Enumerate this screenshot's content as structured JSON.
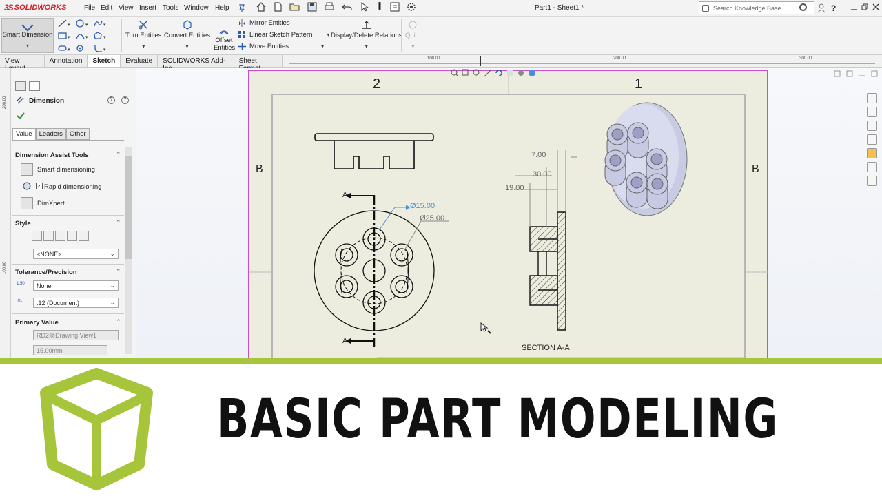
{
  "app": {
    "brand": "SOLIDWORKS",
    "brand_prefix": "3S",
    "doc_title": "Part1 - Sheet1 *",
    "menu": [
      "File",
      "Edit",
      "View",
      "Insert",
      "Tools",
      "Window",
      "Help"
    ],
    "search_placeholder": "Search Knowledge Base",
    "help_glyph": "?"
  },
  "commands": {
    "smart_dimension": "Smart Dimension",
    "trim_entities": "Trim Entities",
    "convert_entities": "Convert Entities",
    "offset_entities": "Offset Entities",
    "mirror_entities": "Mirror Entities",
    "linear_sketch_pattern": "Linear Sketch Pattern",
    "move_entities": "Move Entities",
    "display_delete_relations": "Display/Delete Relations",
    "quick_snaps": "Qui..."
  },
  "tabs": [
    "View Layout",
    "Annotation",
    "Sketch",
    "Evaluate",
    "SOLIDWORKS Add-Ins",
    "Sheet Format"
  ],
  "active_tab": "Sketch",
  "ruler": {
    "top_labels": [
      "100.00",
      "200.00",
      "300.00"
    ],
    "left_labels": [
      "200.00",
      "100.00"
    ]
  },
  "property_manager": {
    "title": "Dimension",
    "tabs": [
      "Value",
      "Leaders",
      "Other"
    ],
    "sections": {
      "assist_tools": "Dimension Assist Tools",
      "style": "Style",
      "tolerance": "Tolerance/Precision",
      "primary_value": "Primary Value"
    },
    "assist_items": [
      "Smart dimensioning",
      "Rapid dimensioning",
      "DimXpert"
    ],
    "rapid_checked": true,
    "style_value": "<NONE>",
    "tolerance_value": "None",
    "precision_value": ".12 (Document)",
    "tolerance_icon_text": "1.50",
    "precision_icon_text": ".01",
    "primary_value_ref": "RD2@Drawing View1",
    "primary_value_num": "15.00mm"
  },
  "drawing": {
    "zone_top_left": "2",
    "zone_top_right": "1",
    "zone_left": "B",
    "zone_right": "B",
    "section_mark": "A",
    "dim_hole": "Ø15.00",
    "dim_bolt_circle": "Ø25.00",
    "dim_7": "7.00",
    "dim_30": "30.00",
    "dim_19": "19.00",
    "section_label": "SECTION A-A"
  },
  "banner": {
    "title": "BASIC PART MODELING",
    "accent_color": "#a6c53a"
  },
  "colors": {
    "sheet_bg": "#ececdf",
    "sketch_blue": "#2a5ca8",
    "sheet_border": "#c94ec9",
    "brand_red": "#d2232a"
  }
}
